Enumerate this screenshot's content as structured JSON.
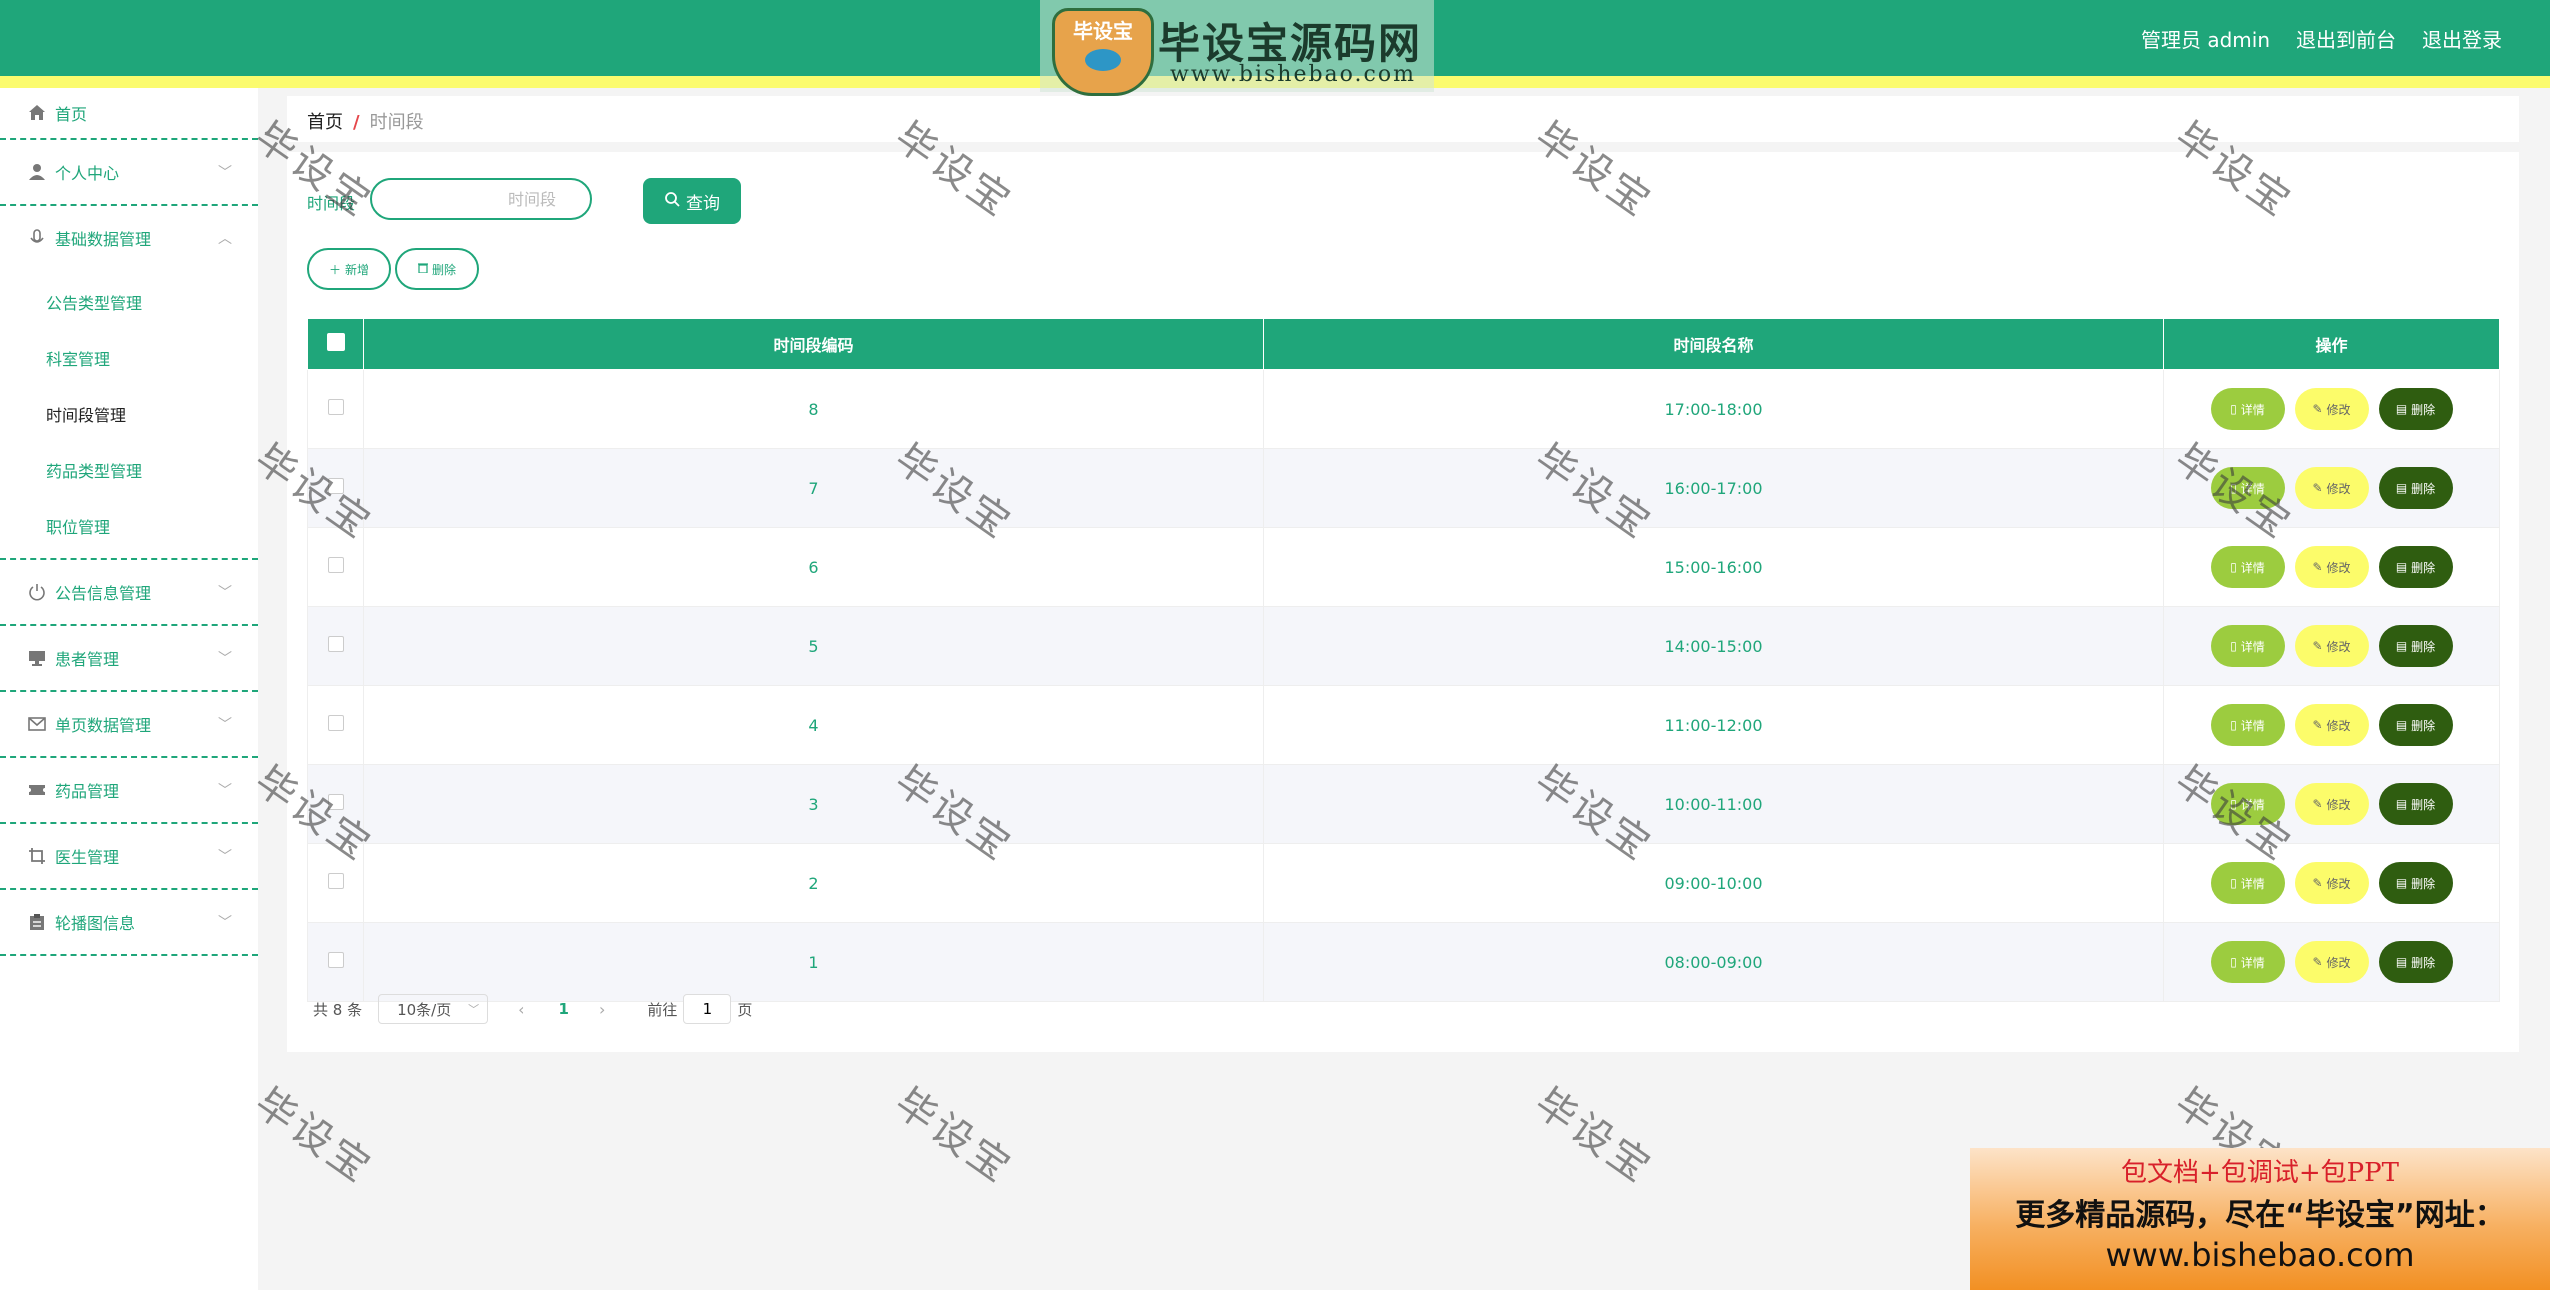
{
  "colors": {
    "primary": "#1fa67a",
    "stripe": "#fbfb6e",
    "detail": "#9ccc3f",
    "edit": "#fcfc6a",
    "delete": "#2f5d10"
  },
  "logo": {
    "badge": "毕设宝",
    "title": "毕设宝源码网",
    "url": "www.bishebao.com"
  },
  "header": {
    "user": "管理员 admin",
    "front": "退出到前台",
    "logout": "退出登录"
  },
  "sidebar": {
    "home": {
      "label": "首页",
      "icon": "home-icon"
    },
    "personal": {
      "label": "个人中心",
      "icon": "user-icon"
    },
    "basic": {
      "label": "基础数据管理",
      "icon": "mic-icon",
      "items": [
        "公告类型管理",
        "科室管理",
        "时间段管理",
        "药品类型管理",
        "职位管理"
      ]
    },
    "groups": [
      {
        "label": "公告信息管理",
        "icon": "power-icon"
      },
      {
        "label": "患者管理",
        "icon": "monitor-icon"
      },
      {
        "label": "单页数据管理",
        "icon": "mail-icon"
      },
      {
        "label": "药品管理",
        "icon": "ticket-icon"
      },
      {
        "label": "医生管理",
        "icon": "crop-icon"
      },
      {
        "label": "轮播图信息",
        "icon": "clipboard-icon"
      }
    ]
  },
  "breadcrumb": {
    "home": "首页",
    "sep": "/",
    "current": "时间段"
  },
  "search": {
    "label": "时间段",
    "placeholder": "时间段",
    "button": "查询"
  },
  "actions": {
    "add": "新增",
    "delete": "删除"
  },
  "table": {
    "headers": [
      "时间段编码",
      "时间段名称",
      "操作"
    ],
    "rows": [
      {
        "code": "8",
        "name": "17:00-18:00"
      },
      {
        "code": "7",
        "name": "16:00-17:00"
      },
      {
        "code": "6",
        "name": "15:00-16:00"
      },
      {
        "code": "5",
        "name": "14:00-15:00"
      },
      {
        "code": "4",
        "name": "11:00-12:00"
      },
      {
        "code": "3",
        "name": "10:00-11:00"
      },
      {
        "code": "2",
        "name": "09:00-10:00"
      },
      {
        "code": "1",
        "name": "08:00-09:00"
      }
    ],
    "ops": {
      "detail": "详情",
      "edit": "修改",
      "delete": "删除"
    }
  },
  "pager": {
    "total": "共 8 条",
    "size": "10条/页",
    "current": "1",
    "goto": "前往",
    "goto_value": "1",
    "unit": "页"
  },
  "watermark": "毕设宝",
  "ad": {
    "line1": "包文档+包调试+包PPT",
    "line2": "更多精品源码，尽在“毕设宝”网址：",
    "line3": "www.bishebao.com"
  }
}
